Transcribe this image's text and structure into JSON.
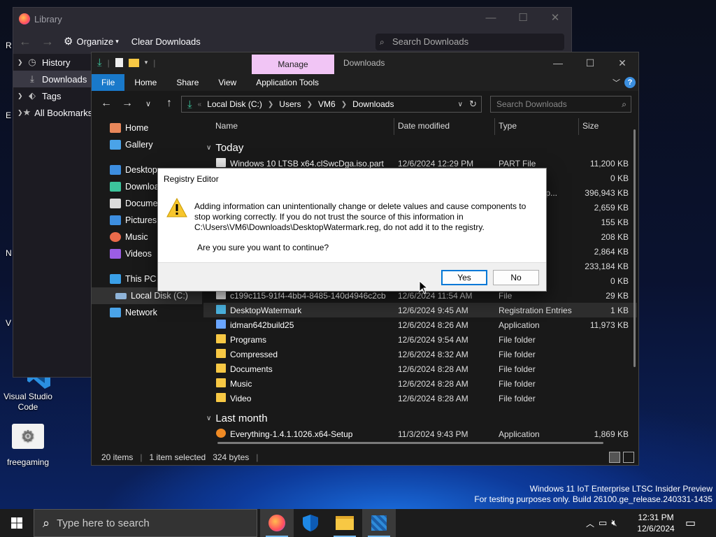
{
  "desktop": {
    "icons": [
      {
        "label": "Visual Studio Code"
      },
      {
        "label": "freegaming"
      }
    ],
    "fragments": [
      "R",
      "E",
      "N",
      "V"
    ],
    "watermark": {
      "line1": "Windows 11 IoT Enterprise LTSC Insider Preview",
      "line2": "For testing purposes only. Build 26100.ge_release.240331-1435"
    }
  },
  "library": {
    "title": "Library",
    "toolbar": {
      "organize": "Organize",
      "clear": "Clear Downloads"
    },
    "search_placeholder": "Search Downloads",
    "sidebar": [
      {
        "label": "History",
        "icon": "clock-icon"
      },
      {
        "label": "Downloads",
        "icon": "download-icon"
      },
      {
        "label": "Tags",
        "icon": "tag-icon"
      },
      {
        "label": "All Bookmarks",
        "icon": "star-icon"
      }
    ]
  },
  "explorer": {
    "manage_tab": "Manage",
    "title": "Downloads",
    "ribbon_tabs": [
      "File",
      "Home",
      "Share",
      "View",
      "Application Tools"
    ],
    "address": {
      "root": "Local Disk (C:)",
      "parts": [
        "Users",
        "VM6",
        "Downloads"
      ]
    },
    "search_placeholder": "Search Downloads",
    "nav": [
      "Home",
      "Gallery",
      "Desktop",
      "Downloads",
      "Documents",
      "Pictures",
      "Music",
      "Videos",
      "This PC",
      "Local Disk (C:)",
      "Network"
    ],
    "columns": {
      "name": "Name",
      "date": "Date modified",
      "type": "Type",
      "size": "Size"
    },
    "groups": {
      "today": "Today",
      "last_month": "Last month"
    },
    "rows_top": [
      {
        "name": "Windows 10 LTSB x64.clSwcDga.iso.part",
        "date": "12/6/2024 12:29 PM",
        "type": "PART File",
        "size": "11,200 KB"
      },
      {
        "name": "",
        "date": "",
        "type": "",
        "size": "0 KB"
      },
      {
        "name": "",
        "date": "",
        "type": "(zipp...",
        "size": "396,943 KB"
      },
      {
        "name": "",
        "date": "",
        "type": "",
        "size": "2,659 KB"
      },
      {
        "name": "",
        "date": "",
        "type": "",
        "size": "155 KB"
      },
      {
        "name": "",
        "date": "",
        "type": "",
        "size": "208 KB"
      },
      {
        "name": "",
        "date": "",
        "type": "",
        "size": "2,864 KB"
      },
      {
        "name": "",
        "date": "",
        "type": "",
        "size": "233,184 KB"
      },
      {
        "name": "",
        "date": "",
        "type": "",
        "size": "0 KB"
      }
    ],
    "rows": [
      {
        "name": "c199c115-91f4-4bb4-8485-140d4946c2cb",
        "date": "12/6/2024 11:54 AM",
        "type": "File",
        "size": "29 KB"
      },
      {
        "name": "DesktopWatermark",
        "date": "12/6/2024 9:45 AM",
        "type": "Registration Entries",
        "size": "1 KB"
      },
      {
        "name": "idman642build25",
        "date": "12/6/2024 8:26 AM",
        "type": "Application",
        "size": "11,973 KB"
      },
      {
        "name": "Programs",
        "date": "12/6/2024 9:54 AM",
        "type": "File folder",
        "size": ""
      },
      {
        "name": "Compressed",
        "date": "12/6/2024 8:32 AM",
        "type": "File folder",
        "size": ""
      },
      {
        "name": "Documents",
        "date": "12/6/2024 8:28 AM",
        "type": "File folder",
        "size": ""
      },
      {
        "name": "Music",
        "date": "12/6/2024 8:28 AM",
        "type": "File folder",
        "size": ""
      },
      {
        "name": "Video",
        "date": "12/6/2024 8:28 AM",
        "type": "File folder",
        "size": ""
      }
    ],
    "last_month_rows": [
      {
        "name": "Everything-1.4.1.1026.x64-Setup",
        "date": "11/3/2024 9:43 PM",
        "type": "Application",
        "size": "1,869 KB"
      }
    ],
    "status": {
      "items": "20 items",
      "selected": "1 item selected",
      "bytes": "324 bytes"
    }
  },
  "dialog": {
    "title": "Registry Editor",
    "message": "Adding information can unintentionally change or delete values and cause components to stop working correctly. If you do not trust the source of this information in C:\\Users\\VM6\\Downloads\\DesktopWatermark.reg, do not add it to the registry.",
    "question": "Are you sure you want to continue?",
    "yes": "Yes",
    "no": "No"
  },
  "taskbar": {
    "search_placeholder": "Type here to search",
    "time": "12:31 PM",
    "date": "12/6/2024"
  }
}
